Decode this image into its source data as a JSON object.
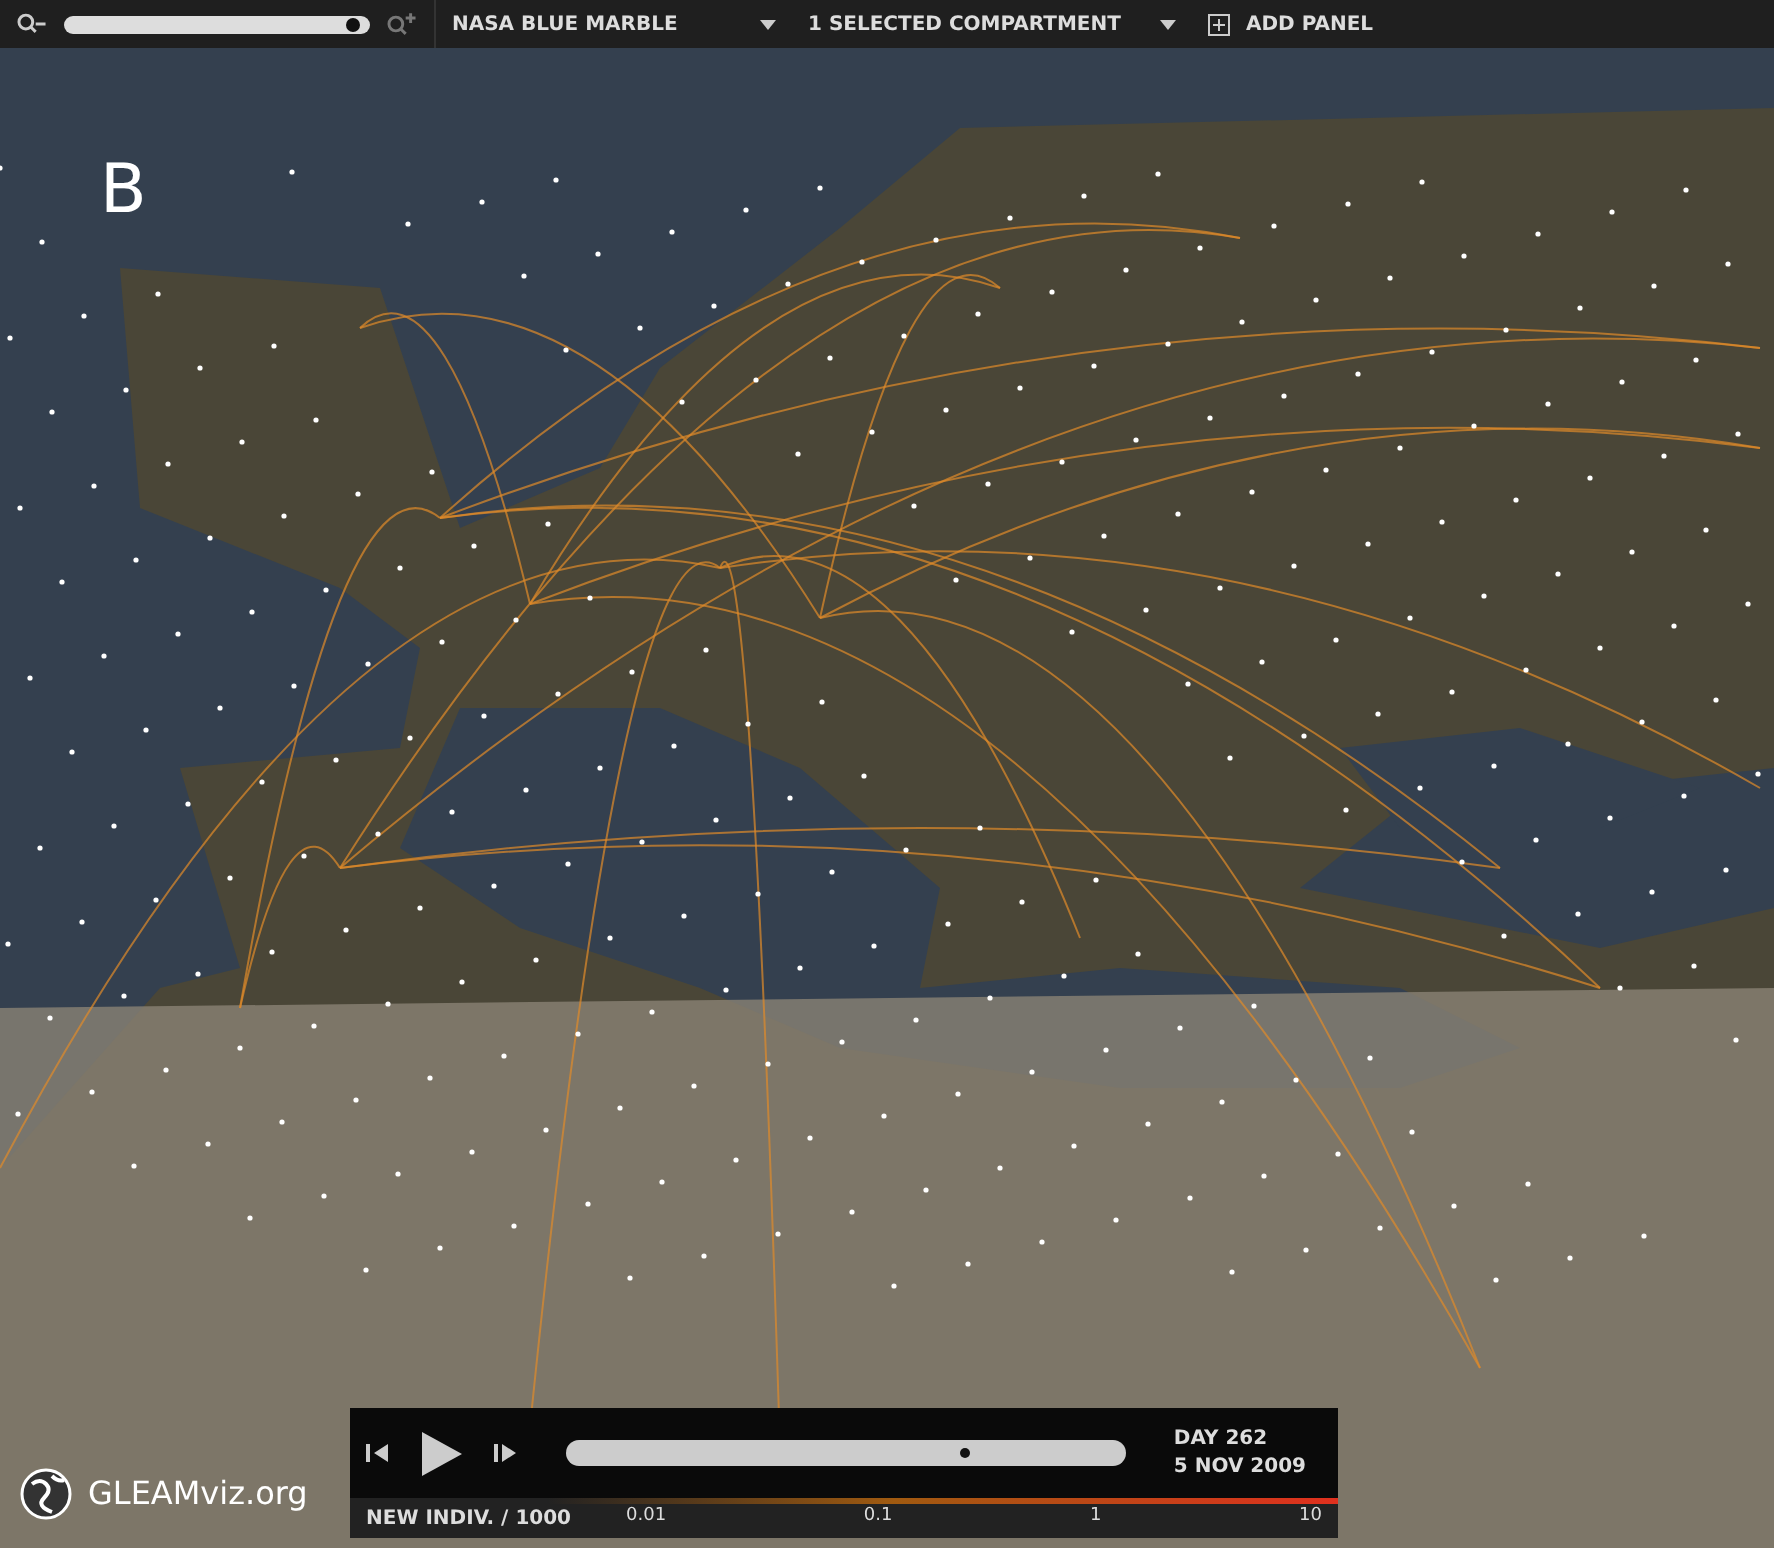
{
  "toolbar": {
    "zoom_slider": {
      "level": 0.97
    },
    "map_layer": "NASA BLUE MARBLE",
    "compartment": "1 SELECTED COMPARTMENT",
    "add_panel": "ADD PANEL"
  },
  "panel_label": "B",
  "logo": "GLEAMviz.org",
  "player": {
    "timeline": {
      "level": 0.71
    },
    "day": "DAY 262",
    "date": "5 NOV 2009",
    "legend_title": "NEW INDIV. / 1000",
    "legend_ticks": [
      "0.01",
      "0.1",
      "1",
      "10"
    ]
  }
}
